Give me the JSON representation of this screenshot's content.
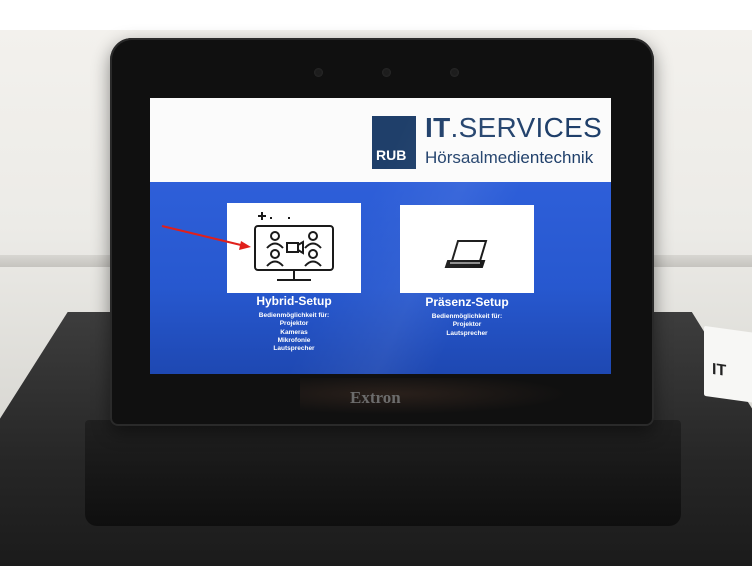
{
  "photo": {
    "caption": ""
  },
  "device": {
    "brand": "Extron"
  },
  "header": {
    "logo_badge": "RUB",
    "logo_title_bold": "IT",
    "logo_title_rest": ".SERVICES",
    "logo_subtitle": "Hörsaalmedientechnik"
  },
  "options": [
    {
      "label": "Hybrid-Setup",
      "description_lines": [
        "Bedienmöglichkeit für:",
        "Projektor",
        "Kameras",
        "Mikrofonie",
        "Lautsprecher"
      ],
      "icon": "video-conference-icon"
    },
    {
      "label": "Präsenz-Setup",
      "description_lines": [
        "Bedienmöglichkeit für:",
        "Projektor",
        "Lautsprecher"
      ],
      "icon": "laptop-icon"
    }
  ],
  "annotation": {
    "color": "#e0201b",
    "target": "Hybrid-Setup"
  },
  "colors": {
    "screen_blue": "#2e5fd9",
    "logo_navy": "#1f3f6a"
  },
  "side_card": {
    "text": "IT"
  }
}
